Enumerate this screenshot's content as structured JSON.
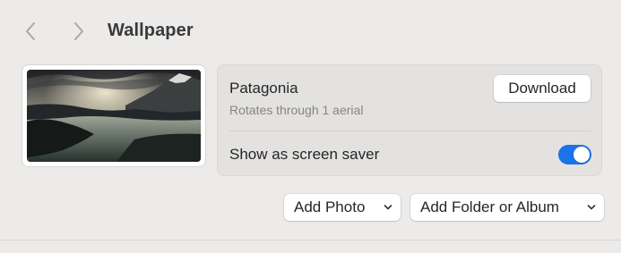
{
  "toolbar": {
    "back_icon": "chevron-left-icon",
    "forward_icon": "chevron-right-icon",
    "title": "Wallpaper"
  },
  "wallpaper": {
    "thumbnail_icon": "aerial-landscape-thumbnail",
    "name": "Patagonia",
    "subtitle": "Rotates through 1 aerial",
    "download_label": "Download",
    "screen_saver_label": "Show as screen saver",
    "screen_saver_enabled": true
  },
  "actions": {
    "add_photo_label": "Add Photo",
    "add_folder_label": "Add Folder or Album",
    "popup_icon": "chevron-down-icon"
  },
  "colors": {
    "background": "#ecebea",
    "card": "#e3e2e1",
    "accent": "#1a73e8"
  }
}
